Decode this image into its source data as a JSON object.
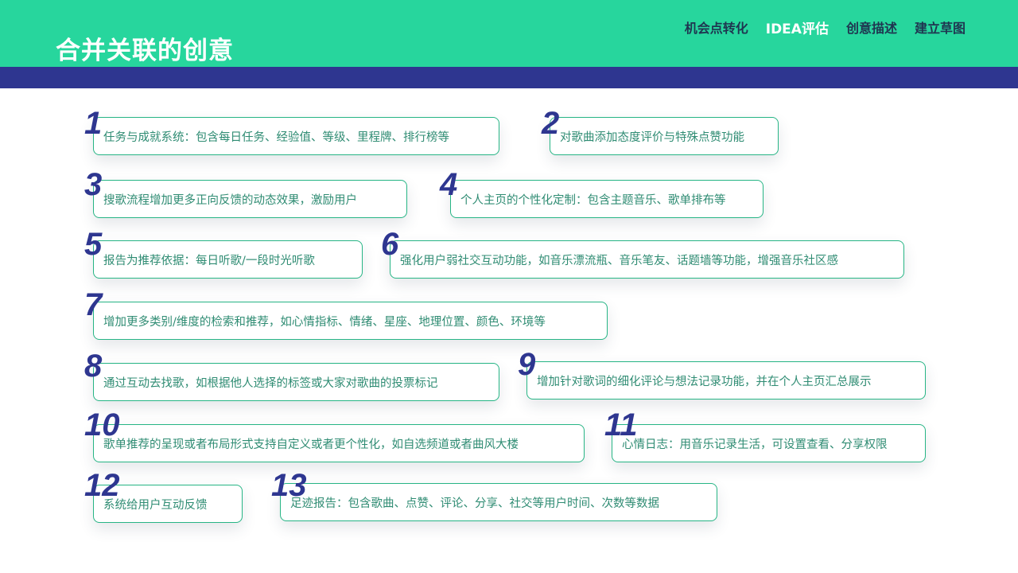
{
  "header": {
    "title": "合并关联的创意",
    "nav": [
      {
        "label": "机会点转化",
        "active": false
      },
      {
        "label": "IDEA评估",
        "active": true
      },
      {
        "label": "创意描述",
        "active": false
      },
      {
        "label": "建立草图",
        "active": false
      }
    ]
  },
  "colors": {
    "header_green": "#27d69d",
    "band_navy": "#2e3690",
    "card_border": "#27b585",
    "card_text": "#2f8c73"
  },
  "ideas": [
    {
      "num": "1",
      "text": "任务与成就系统：包含每日任务、经验值、等级、里程牌、排行榜等"
    },
    {
      "num": "2",
      "text": "对歌曲添加态度评价与特殊点赞功能"
    },
    {
      "num": "3",
      "text": "搜歌流程增加更多正向反馈的动态效果，激励用户"
    },
    {
      "num": "4",
      "text": "个人主页的个性化定制：包含主题音乐、歌单排布等"
    },
    {
      "num": "5",
      "text": "报告为推荐依据：每日听歌/一段时光听歌"
    },
    {
      "num": "6",
      "text": "强化用户弱社交互动功能，如音乐漂流瓶、音乐笔友、话题墙等功能，增强音乐社区感"
    },
    {
      "num": "7",
      "text": "增加更多类别/维度的检索和推荐，如心情指标、情绪、星座、地理位置、颜色、环境等"
    },
    {
      "num": "8",
      "text": "通过互动去找歌，如根据他人选择的标签或大家对歌曲的投票标记"
    },
    {
      "num": "9",
      "text": "增加针对歌词的细化评论与想法记录功能，并在个人主页汇总展示"
    },
    {
      "num": "10",
      "text": "歌单推荐的呈现或者布局形式支持自定义或者更个性化，如自选频道或者曲风大楼"
    },
    {
      "num": "11",
      "text": "心情日志：用音乐记录生活，可设置查看、分享权限"
    },
    {
      "num": "12",
      "text": "系统给用户互动反馈"
    },
    {
      "num": "13",
      "text": "足迹报告：包含歌曲、点赞、评论、分享、社交等用户时间、次数等数据"
    }
  ]
}
